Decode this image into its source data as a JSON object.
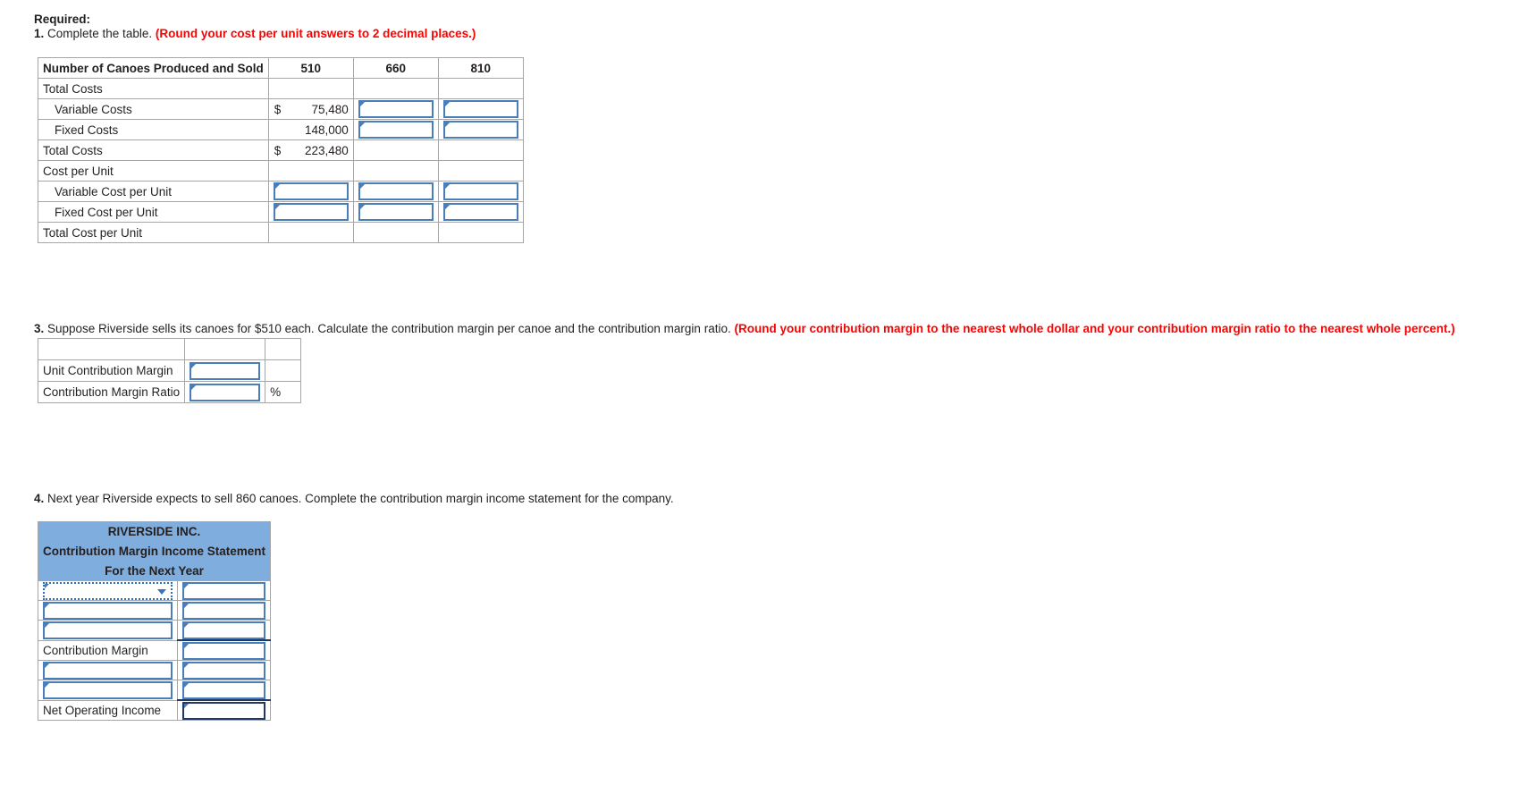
{
  "required_heading": "Required:",
  "q1": {
    "number": "1.",
    "text": " Complete the table. ",
    "note": "(Round your cost per unit answers to 2 decimal places.)"
  },
  "table_costs": {
    "header": [
      "Number of Canoes Produced and Sold",
      "510",
      "660",
      "810"
    ],
    "rows": [
      {
        "label": "Total Costs",
        "indent": false,
        "cells": [
          "",
          "",
          ""
        ]
      },
      {
        "label": "Variable Costs",
        "indent": true,
        "cells": [
          "$|75,480",
          "",
          ""
        ]
      },
      {
        "label": "Fixed Costs",
        "indent": true,
        "cells": [
          "|148,000",
          "",
          ""
        ]
      },
      {
        "label": "Total Costs",
        "indent": false,
        "cells": [
          "$|223,480",
          "",
          ""
        ]
      },
      {
        "label": "Cost per Unit",
        "indent": false,
        "cells": [
          "",
          "",
          ""
        ]
      },
      {
        "label": "Variable Cost per Unit",
        "indent": true,
        "cells": [
          "",
          "",
          ""
        ]
      },
      {
        "label": "Fixed Cost per Unit",
        "indent": true,
        "cells": [
          "",
          "",
          ""
        ]
      },
      {
        "label": "Total Cost per Unit",
        "indent": false,
        "cells": [
          "",
          "",
          ""
        ]
      }
    ]
  },
  "q3": {
    "number": "3.",
    "text": " Suppose Riverside sells its canoes for $510 each. Calculate the contribution margin per canoe and the contribution margin ratio. ",
    "note": "(Round your contribution margin to the nearest whole dollar and your contribution margin ratio to the nearest whole percent.)"
  },
  "table_cm": {
    "rows": [
      {
        "label": "Unit Contribution Margin",
        "suffix": ""
      },
      {
        "label": "Contribution Margin Ratio",
        "suffix": "%"
      }
    ]
  },
  "q4": {
    "number": "4.",
    "text": " Next year Riverside expects to sell 860 canoes. Complete the contribution margin income statement for the company."
  },
  "table_is": {
    "titles": [
      "RIVERSIDE INC.",
      "Contribution Margin Income Statement",
      "For the Next Year"
    ],
    "rows": [
      {
        "kind": "select",
        "label": "",
        "value": ""
      },
      {
        "kind": "input",
        "label": "",
        "value": ""
      },
      {
        "kind": "input",
        "label": "",
        "value": ""
      },
      {
        "kind": "static",
        "label": "Contribution Margin",
        "value": ""
      },
      {
        "kind": "input",
        "label": "",
        "value": ""
      },
      {
        "kind": "input",
        "label": "",
        "value": ""
      },
      {
        "kind": "static",
        "label": "Net Operating Income",
        "value": ""
      }
    ],
    "dropdown_placeholder": ""
  },
  "colors": {
    "header_blue": "#7FADDE",
    "field_border": "#4a7ebb",
    "note_red": "#ff0000",
    "grid": "#a6a6a6"
  }
}
